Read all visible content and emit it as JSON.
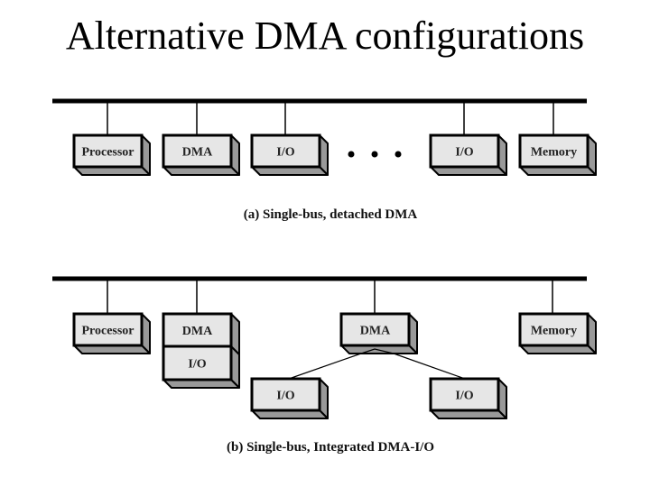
{
  "title": "Alternative DMA configurations",
  "colors": {
    "face": "#e6e6e6",
    "side": "#999999",
    "line": "#000000"
  },
  "diagram_a": {
    "caption": "(a) Single-bus, detached DMA",
    "boxes": [
      {
        "id": "processor",
        "label": "Processor"
      },
      {
        "id": "dma",
        "label": "DMA"
      },
      {
        "id": "io-1",
        "label": "I/O"
      },
      {
        "id": "io-2",
        "label": "I/O"
      },
      {
        "id": "memory",
        "label": "Memory"
      }
    ],
    "ellipsis": "• • •"
  },
  "diagram_b": {
    "caption": "(b) Single-bus, Integrated DMA-I/O",
    "boxes": [
      {
        "id": "processor",
        "label": "Processor"
      },
      {
        "id": "dma-integrated",
        "label": "DMA"
      },
      {
        "id": "io-integrated",
        "label": "I/O"
      },
      {
        "id": "dma-shared",
        "label": "DMA"
      },
      {
        "id": "io-left",
        "label": "I/O"
      },
      {
        "id": "io-right",
        "label": "I/O"
      },
      {
        "id": "memory",
        "label": "Memory"
      }
    ]
  }
}
